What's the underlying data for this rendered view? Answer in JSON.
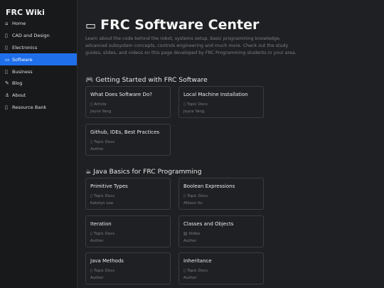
{
  "sidebar": {
    "brand": "FRC Wiki",
    "items": [
      {
        "icon": "⌂",
        "label": "Home"
      },
      {
        "icon": "▯",
        "label": "CAD and Design"
      },
      {
        "icon": "▯",
        "label": "Electronics"
      },
      {
        "icon": "▭",
        "label": "Software"
      },
      {
        "icon": "▯",
        "label": "Business"
      },
      {
        "icon": "✎",
        "label": "Blog"
      },
      {
        "icon": "⚓",
        "label": "About"
      },
      {
        "icon": "▯",
        "label": "Resource Bank"
      }
    ]
  },
  "header": {
    "icon": "▭",
    "title": "FRC Software Center",
    "intro": "Learn about the code behind the robot, systems setup, basic programming knowledge, advanced subsystem concepts, controls engineering and much more. Check out the study guides, slides, and videos on this page developed by FRC Programming students in your area."
  },
  "sections": [
    {
      "icon": "🎮",
      "title": "Getting Started with FRC Software",
      "cards": [
        {
          "title": "What Does Software Do?",
          "type_icon": "▯",
          "type": "Article",
          "author": "Joyce Yang"
        },
        {
          "title": "Local Machine Installation",
          "type_icon": "▯",
          "type": "Topic Docs",
          "author": "Joyce Yang"
        },
        {
          "title": "Github, IDEs, Best Practices",
          "type_icon": "▯",
          "type": "Topic Docs",
          "author": "Author"
        }
      ]
    },
    {
      "icon": "☕",
      "title": "Java Basics for FRC Programming",
      "cards": [
        {
          "title": "Primitive Types",
          "type_icon": "▯",
          "type": "Topic Docs",
          "author": "Katelyn Lee"
        },
        {
          "title": "Boolean Expressions",
          "type_icon": "▯",
          "type": "Topic Docs",
          "author": "Allison Vu"
        },
        {
          "title": "Iteration",
          "type_icon": "▯",
          "type": "Topic Docs",
          "author": "Author"
        },
        {
          "title": "Classes and Objects",
          "type_icon": "▧",
          "type": "Slides",
          "author": "Author"
        },
        {
          "title": "Java Methods",
          "type_icon": "▯",
          "type": "Topic Docs",
          "author": "Author"
        },
        {
          "title": "Inheritance",
          "type_icon": "▯",
          "type": "Topic Docs",
          "author": "Author"
        }
      ]
    }
  ],
  "colors": {
    "accent": "#1f6feb",
    "background": "#1f2023",
    "sidebar": "#18191b",
    "muted": "#7c7d80"
  }
}
